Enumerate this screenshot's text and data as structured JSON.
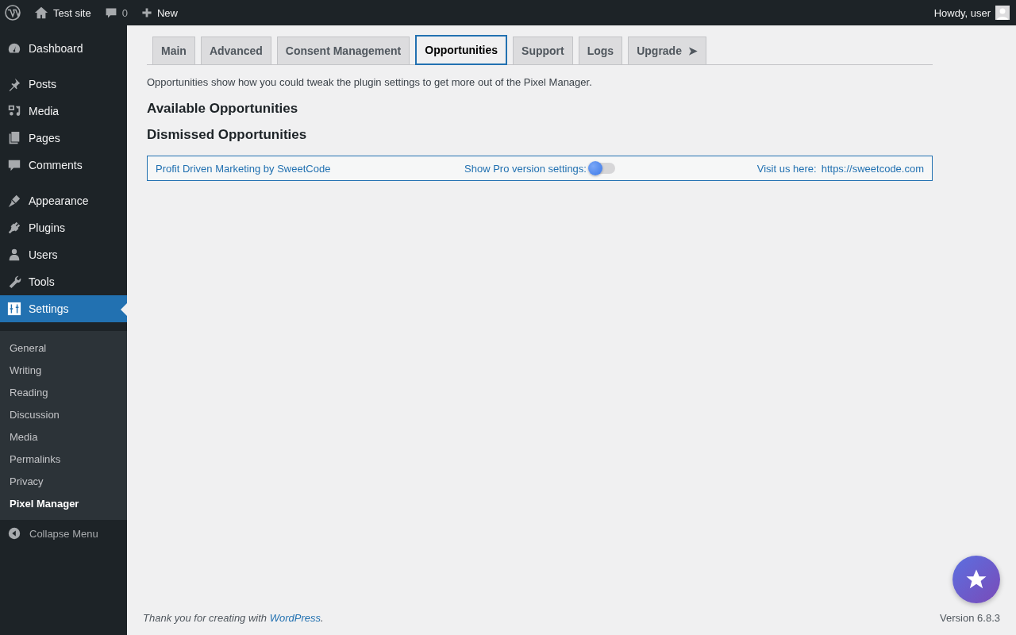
{
  "admin_bar": {
    "site": "Test site",
    "comments": "0",
    "new": "New",
    "greeting": "Howdy, user"
  },
  "sidebar": {
    "groups": [
      [
        {
          "label": "Dashboard",
          "selected": false
        }
      ],
      [
        {
          "label": "Posts",
          "selected": false
        },
        {
          "label": "Media",
          "selected": false
        },
        {
          "label": "Pages",
          "selected": false
        },
        {
          "label": "Comments",
          "selected": false
        }
      ],
      [
        {
          "label": "Appearance",
          "selected": false
        },
        {
          "label": "Plugins",
          "selected": false
        },
        {
          "label": "Users",
          "selected": false
        },
        {
          "label": "Tools",
          "selected": false
        },
        {
          "label": "Settings",
          "selected": true
        }
      ]
    ],
    "submenu": [
      {
        "label": "General",
        "selected": false
      },
      {
        "label": "Writing",
        "selected": false
      },
      {
        "label": "Reading",
        "selected": false
      },
      {
        "label": "Discussion",
        "selected": false
      },
      {
        "label": "Media",
        "selected": false
      },
      {
        "label": "Permalinks",
        "selected": false
      },
      {
        "label": "Privacy",
        "selected": false
      },
      {
        "label": "Pixel Manager",
        "selected": true
      }
    ],
    "collapse": "Collapse Menu"
  },
  "tabs": [
    {
      "label": "Main",
      "selected": false
    },
    {
      "label": "Advanced",
      "selected": false
    },
    {
      "label": "Consent Management",
      "selected": false
    },
    {
      "label": "Opportunities",
      "selected": true
    },
    {
      "label": "Support",
      "selected": false
    },
    {
      "label": "Logs",
      "selected": false
    },
    {
      "label": "Upgrade",
      "selected": false,
      "arrow": "➤"
    }
  ],
  "intro": "Opportunities show how you could tweak the plugin settings to get more out of the Pixel Manager.",
  "headings": [
    "Available Opportunities",
    "Dismissed Opportunities"
  ],
  "info_bar": {
    "brand": "Profit Driven Marketing by SweetCode",
    "pro_label": "Show Pro version settings:",
    "pro_on": false,
    "visit_label": "Visit us here:",
    "visit_link": "https://sweetcode.com"
  },
  "footer": {
    "thanks_before": "Thank you for creating with ",
    "thanks_link": "WordPress",
    "thanks_after": ".",
    "version": "Version 6.8.3"
  }
}
